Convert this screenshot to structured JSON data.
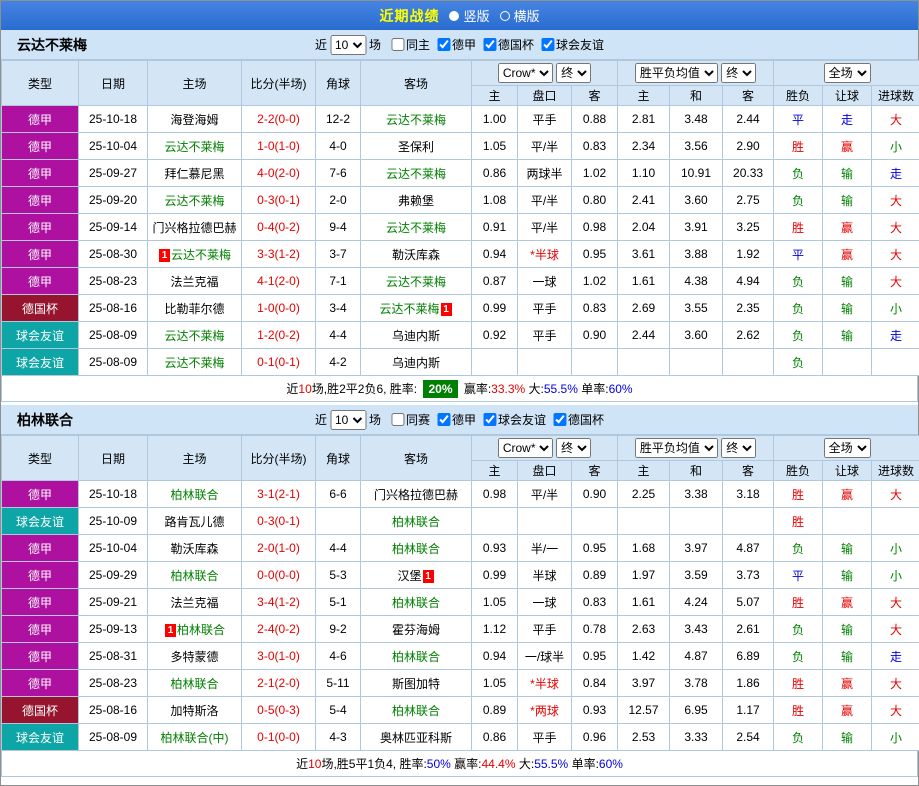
{
  "colors": {
    "topbar_blue": "#2a6cd0",
    "header_bg": "#cfe4f7",
    "table_head_bg": "#d4e6f6",
    "border": "#afc8de",
    "league": "#ae109f",
    "cup": "#96142e",
    "friendly": "#0da5a5",
    "focus_team": "#008000",
    "score_red": "#e80000",
    "win_red": "#e80000",
    "draw_blue": "#0000dd",
    "lose_green": "#008000",
    "rate_badge_bg": "#008000"
  },
  "topbar": {
    "title": "近期战绩",
    "vertical": "竖版",
    "horizontal": "横版"
  },
  "columns": {
    "type": "类型",
    "date": "日期",
    "home": "主场",
    "score": "比分(半场)",
    "corner": "角球",
    "away": "客场",
    "odds_home": "主",
    "odds_handicap": "盘口",
    "odds_away": "客",
    "avg_home": "主",
    "avg_draw": "和",
    "avg_away": "客",
    "result": "胜负",
    "handicap_result": "让球",
    "goals": "进球数"
  },
  "dropdowns": {
    "odds_source": "Crow*",
    "final1": "终",
    "avg": "胜平负均值",
    "final2": "终",
    "scope": "全场"
  },
  "sections": [
    {
      "team": "云达不莱梅",
      "filter": {
        "near": "近",
        "count": "10",
        "games": "场",
        "checkboxes": [
          {
            "label": "同主",
            "checked": false
          },
          {
            "label": "德甲",
            "checked": true
          },
          {
            "label": "德国杯",
            "checked": true
          },
          {
            "label": "球会友谊",
            "checked": true
          }
        ]
      },
      "rows": [
        {
          "type": "德甲",
          "date": "25-10-18",
          "home": {
            "text": "海登海姆"
          },
          "score": "2-2(0-0)",
          "corner": "12-2",
          "away": {
            "text": "云达不莱梅",
            "focus": true
          },
          "odds": [
            "1.00",
            "平手",
            "0.88"
          ],
          "avg": [
            "2.81",
            "3.48",
            "2.44"
          ],
          "res": [
            "平",
            "走",
            "大"
          ]
        },
        {
          "type": "德甲",
          "date": "25-10-04",
          "home": {
            "text": "云达不莱梅",
            "focus": true
          },
          "score": "1-0(1-0)",
          "corner": "4-0",
          "away": {
            "text": "圣保利"
          },
          "odds": [
            "1.05",
            "平/半",
            "0.83"
          ],
          "avg": [
            "2.34",
            "3.56",
            "2.90"
          ],
          "res": [
            "胜",
            "赢",
            "小"
          ]
        },
        {
          "type": "德甲",
          "date": "25-09-27",
          "home": {
            "text": "拜仁慕尼黑"
          },
          "score": "4-0(2-0)",
          "corner": "7-6",
          "away": {
            "text": "云达不莱梅",
            "focus": true
          },
          "odds": [
            "0.86",
            "两球半",
            "1.02"
          ],
          "avg": [
            "1.10",
            "10.91",
            "20.33"
          ],
          "res": [
            "负",
            "输",
            "走"
          ]
        },
        {
          "type": "德甲",
          "date": "25-09-20",
          "home": {
            "text": "云达不莱梅",
            "focus": true
          },
          "score": "0-3(0-1)",
          "corner": "2-0",
          "away": {
            "text": "弗赖堡"
          },
          "odds": [
            "1.08",
            "平/半",
            "0.80"
          ],
          "avg": [
            "2.41",
            "3.60",
            "2.75"
          ],
          "res": [
            "负",
            "输",
            "大"
          ]
        },
        {
          "type": "德甲",
          "date": "25-09-14",
          "home": {
            "text": "门兴格拉德巴赫"
          },
          "score": "0-4(0-2)",
          "corner": "9-4",
          "away": {
            "text": "云达不莱梅",
            "focus": true
          },
          "odds": [
            "0.91",
            "平/半",
            "0.98"
          ],
          "avg": [
            "2.04",
            "3.91",
            "3.25"
          ],
          "res": [
            "胜",
            "赢",
            "大"
          ]
        },
        {
          "type": "德甲",
          "date": "25-08-30",
          "home": {
            "text": "云达不莱梅",
            "focus": true,
            "badge": "1",
            "badgePos": "before"
          },
          "score": "3-3(1-2)",
          "corner": "3-7",
          "away": {
            "text": "勒沃库森"
          },
          "odds": [
            "0.94",
            "*半球",
            "0.95"
          ],
          "avg": [
            "3.61",
            "3.88",
            "1.92"
          ],
          "res": [
            "平",
            "赢",
            "大"
          ]
        },
        {
          "type": "德甲",
          "date": "25-08-23",
          "home": {
            "text": "法兰克福"
          },
          "score": "4-1(2-0)",
          "corner": "7-1",
          "away": {
            "text": "云达不莱梅",
            "focus": true
          },
          "odds": [
            "0.87",
            "一球",
            "1.02"
          ],
          "avg": [
            "1.61",
            "4.38",
            "4.94"
          ],
          "res": [
            "负",
            "输",
            "大"
          ]
        },
        {
          "type": "德国杯",
          "date": "25-08-16",
          "home": {
            "text": "比勒菲尔德"
          },
          "score": "1-0(0-0)",
          "corner": "3-4",
          "away": {
            "text": "云达不莱梅",
            "focus": true,
            "badge": "1",
            "badgePos": "after"
          },
          "odds": [
            "0.99",
            "平手",
            "0.83"
          ],
          "avg": [
            "2.69",
            "3.55",
            "2.35"
          ],
          "res": [
            "负",
            "输",
            "小"
          ]
        },
        {
          "type": "球会友谊",
          "date": "25-08-09",
          "home": {
            "text": "云达不莱梅",
            "focus": true
          },
          "score": "1-2(0-2)",
          "corner": "4-4",
          "away": {
            "text": "乌迪内斯"
          },
          "odds": [
            "0.92",
            "平手",
            "0.90"
          ],
          "avg": [
            "2.44",
            "3.60",
            "2.62"
          ],
          "res": [
            "负",
            "输",
            "走"
          ]
        },
        {
          "type": "球会友谊",
          "date": "25-08-09",
          "home": {
            "text": "云达不莱梅",
            "focus": true
          },
          "score": "0-1(0-1)",
          "corner": "4-2",
          "away": {
            "text": "乌迪内斯"
          },
          "odds": [
            "",
            "",
            ""
          ],
          "avg": [
            "",
            "",
            ""
          ],
          "res": [
            "负",
            "",
            ""
          ]
        }
      ],
      "summary": [
        {
          "t": "近"
        },
        {
          "t": "10",
          "c": "red"
        },
        {
          "t": "场,胜2平2负6, 胜率: "
        },
        {
          "t": "20%",
          "c": "badge"
        },
        {
          "t": " 赢率:"
        },
        {
          "t": "33.3%",
          "c": "red"
        },
        {
          "t": " 大:"
        },
        {
          "t": "55.5%",
          "c": "blue"
        },
        {
          "t": " 单率:"
        },
        {
          "t": "60%",
          "c": "blue"
        }
      ]
    },
    {
      "team": "柏林联合",
      "filter": {
        "near": "近",
        "count": "10",
        "games": "场",
        "checkboxes": [
          {
            "label": "同赛",
            "checked": false
          },
          {
            "label": "德甲",
            "checked": true
          },
          {
            "label": "球会友谊",
            "checked": true
          },
          {
            "label": "德国杯",
            "checked": true
          }
        ]
      },
      "rows": [
        {
          "type": "德甲",
          "date": "25-10-18",
          "home": {
            "text": "柏林联合",
            "focus": true
          },
          "score": "3-1(2-1)",
          "corner": "6-6",
          "away": {
            "text": "门兴格拉德巴赫"
          },
          "odds": [
            "0.98",
            "平/半",
            "0.90"
          ],
          "avg": [
            "2.25",
            "3.38",
            "3.18"
          ],
          "res": [
            "胜",
            "赢",
            "大"
          ]
        },
        {
          "type": "球会友谊",
          "date": "25-10-09",
          "home": {
            "text": "路肯瓦儿德"
          },
          "score": "0-3(0-1)",
          "corner": "",
          "away": {
            "text": "柏林联合",
            "focus": true
          },
          "odds": [
            "",
            "",
            ""
          ],
          "avg": [
            "",
            "",
            ""
          ],
          "res": [
            "胜",
            "",
            ""
          ]
        },
        {
          "type": "德甲",
          "date": "25-10-04",
          "home": {
            "text": "勒沃库森"
          },
          "score": "2-0(1-0)",
          "corner": "4-4",
          "away": {
            "text": "柏林联合",
            "focus": true
          },
          "odds": [
            "0.93",
            "半/一",
            "0.95"
          ],
          "avg": [
            "1.68",
            "3.97",
            "4.87"
          ],
          "res": [
            "负",
            "输",
            "小"
          ]
        },
        {
          "type": "德甲",
          "date": "25-09-29",
          "home": {
            "text": "柏林联合",
            "focus": true
          },
          "score": "0-0(0-0)",
          "corner": "5-3",
          "away": {
            "text": "汉堡",
            "badge": "1",
            "badgePos": "after"
          },
          "odds": [
            "0.99",
            "半球",
            "0.89"
          ],
          "avg": [
            "1.97",
            "3.59",
            "3.73"
          ],
          "res": [
            "平",
            "输",
            "小"
          ]
        },
        {
          "type": "德甲",
          "date": "25-09-21",
          "home": {
            "text": "法兰克福"
          },
          "score": "3-4(1-2)",
          "corner": "5-1",
          "away": {
            "text": "柏林联合",
            "focus": true
          },
          "odds": [
            "1.05",
            "一球",
            "0.83"
          ],
          "avg": [
            "1.61",
            "4.24",
            "5.07"
          ],
          "res": [
            "胜",
            "赢",
            "大"
          ]
        },
        {
          "type": "德甲",
          "date": "25-09-13",
          "home": {
            "text": "柏林联合",
            "focus": true,
            "badge": "1",
            "badgePos": "before"
          },
          "score": "2-4(0-2)",
          "corner": "9-2",
          "away": {
            "text": "霍芬海姆"
          },
          "odds": [
            "1.12",
            "平手",
            "0.78"
          ],
          "avg": [
            "2.63",
            "3.43",
            "2.61"
          ],
          "res": [
            "负",
            "输",
            "大"
          ]
        },
        {
          "type": "德甲",
          "date": "25-08-31",
          "home": {
            "text": "多特蒙德"
          },
          "score": "3-0(1-0)",
          "corner": "4-6",
          "away": {
            "text": "柏林联合",
            "focus": true
          },
          "odds": [
            "0.94",
            "一/球半",
            "0.95"
          ],
          "avg": [
            "1.42",
            "4.87",
            "6.89"
          ],
          "res": [
            "负",
            "输",
            "走"
          ]
        },
        {
          "type": "德甲",
          "date": "25-08-23",
          "home": {
            "text": "柏林联合",
            "focus": true
          },
          "score": "2-1(2-0)",
          "corner": "5-11",
          "away": {
            "text": "斯图加特"
          },
          "odds": [
            "1.05",
            "*半球",
            "0.84"
          ],
          "avg": [
            "3.97",
            "3.78",
            "1.86"
          ],
          "res": [
            "胜",
            "赢",
            "大"
          ]
        },
        {
          "type": "德国杯",
          "date": "25-08-16",
          "home": {
            "text": "加特斯洛"
          },
          "score": "0-5(0-3)",
          "corner": "5-4",
          "away": {
            "text": "柏林联合",
            "focus": true
          },
          "odds": [
            "0.89",
            "*两球",
            "0.93"
          ],
          "avg": [
            "12.57",
            "6.95",
            "1.17"
          ],
          "res": [
            "胜",
            "赢",
            "大"
          ]
        },
        {
          "type": "球会友谊",
          "date": "25-08-09",
          "home": {
            "text": "柏林联合(中)",
            "focus": true
          },
          "score": "0-1(0-0)",
          "corner": "4-3",
          "away": {
            "text": "奥林匹亚科斯"
          },
          "odds": [
            "0.86",
            "平手",
            "0.96"
          ],
          "avg": [
            "2.53",
            "3.33",
            "2.54"
          ],
          "res": [
            "负",
            "输",
            "小"
          ]
        }
      ],
      "summary": [
        {
          "t": "近"
        },
        {
          "t": "10",
          "c": "red"
        },
        {
          "t": "场,胜5平1负4, 胜率:"
        },
        {
          "t": "50%",
          "c": "blue"
        },
        {
          "t": " 赢率:"
        },
        {
          "t": "44.4%",
          "c": "red"
        },
        {
          "t": " 大:"
        },
        {
          "t": "55.5%",
          "c": "blue"
        },
        {
          "t": " 单率:"
        },
        {
          "t": "60%",
          "c": "blue"
        }
      ]
    }
  ]
}
